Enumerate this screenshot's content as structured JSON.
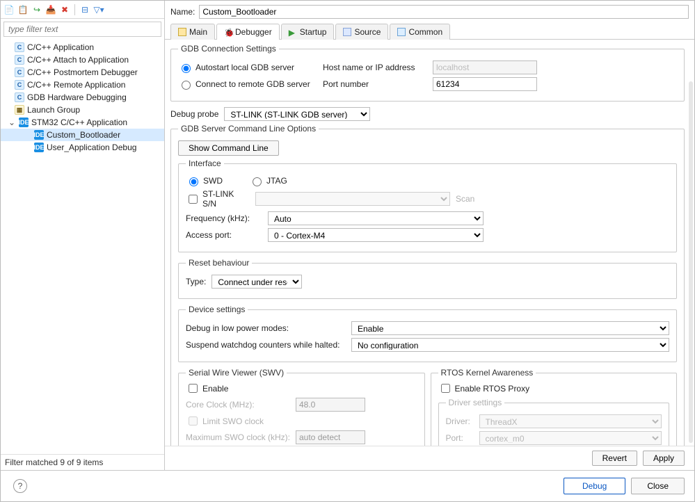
{
  "toolbar_icons": [
    "new",
    "copy",
    "run",
    "export",
    "delete",
    "expand",
    "filter"
  ],
  "filter_placeholder": "type filter text",
  "tree": [
    {
      "label": "C/C++ Application",
      "icon": "c"
    },
    {
      "label": "C/C++ Attach to Application",
      "icon": "c"
    },
    {
      "label": "C/C++ Postmortem Debugger",
      "icon": "c"
    },
    {
      "label": "C/C++ Remote Application",
      "icon": "c"
    },
    {
      "label": "GDB Hardware Debugging",
      "icon": "c"
    },
    {
      "label": "Launch Group",
      "icon": "g"
    },
    {
      "label": "STM32 C/C++ Application",
      "icon": "i",
      "expandable": true,
      "children": [
        {
          "label": "Custom_Bootloader",
          "icon": "i",
          "selected": true
        },
        {
          "label": "User_Application Debug",
          "icon": "i"
        }
      ]
    }
  ],
  "filter_count": "Filter matched 9 of 9 items",
  "name_label": "Name:",
  "name_value": "Custom_Bootloader",
  "tabs": [
    {
      "label": "Main"
    },
    {
      "label": "Debugger",
      "active": true
    },
    {
      "label": "Startup"
    },
    {
      "label": "Source"
    },
    {
      "label": "Common"
    }
  ],
  "gdb_conn": {
    "legend": "GDB Connection Settings",
    "auto_label": "Autostart local GDB server",
    "remote_label": "Connect to remote GDB server",
    "host_label": "Host name or IP address",
    "host_value": "localhost",
    "port_label": "Port number",
    "port_value": "61234"
  },
  "debug_probe": {
    "label": "Debug probe",
    "value": "ST-LINK (ST-LINK GDB server)"
  },
  "server_opts": {
    "legend": "GDB Server Command Line Options",
    "show_btn": "Show Command Line",
    "interface": {
      "legend": "Interface",
      "swd": "SWD",
      "jtag": "JTAG",
      "sn_label": "ST-LINK S/N",
      "scan": "Scan",
      "freq_label": "Frequency (kHz):",
      "freq_value": "Auto",
      "port_label": "Access port:",
      "port_value": "0 - Cortex-M4"
    },
    "reset": {
      "legend": "Reset behaviour",
      "type_label": "Type:",
      "type_value": "Connect under reset"
    },
    "device": {
      "legend": "Device settings",
      "low_power_label": "Debug in low power modes:",
      "low_power_value": "Enable",
      "wdog_label": "Suspend watchdog counters while halted:",
      "wdog_value": "No configuration"
    },
    "swv": {
      "legend": "Serial Wire Viewer (SWV)",
      "enable": "Enable",
      "core_label": "Core Clock (MHz):",
      "core_value": "48.0",
      "limit_label": "Limit SWO clock",
      "max_label": "Maximum SWO clock (kHz):",
      "max_value": "auto detect"
    },
    "rtos": {
      "legend": "RTOS Kernel Awareness",
      "enable": "Enable RTOS Proxy",
      "drv_legend": "Driver settings",
      "drv_label": "Driver:",
      "drv_value": "ThreadX",
      "port_label": "Port:",
      "port_value": "cortex_m0"
    }
  },
  "buttons": {
    "revert": "Revert",
    "apply": "Apply",
    "debug": "Debug",
    "close": "Close"
  }
}
